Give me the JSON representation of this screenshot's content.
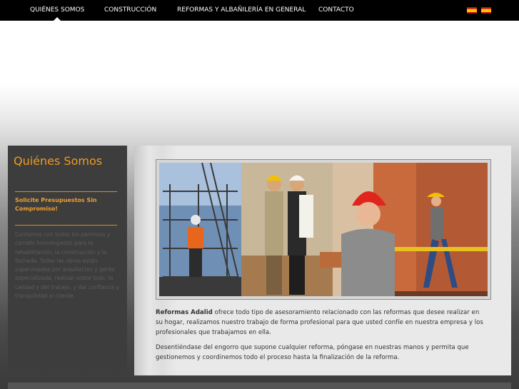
{
  "nav": {
    "items": [
      {
        "label": "QUIÉNES SOMOS",
        "active": true
      },
      {
        "label": "CONSTRUCCIÓN",
        "active": false
      },
      {
        "label": "REFORMAS Y ALBAÑILERÍA EN GENERAL",
        "active": false
      },
      {
        "label": "CONTACTO",
        "active": false
      }
    ],
    "flags": [
      "spanish-flag-icon",
      "spanish-flag-icon"
    ]
  },
  "sidebar": {
    "title": "Quiénes Somos",
    "quote_link": "Solicite Presupuestos Sin Compromiso!",
    "text": "Contamos con todos los permisos y carnets homologados para la rehabilitación, la construcción y la fachada. Todas las obras están supervisadas por arquitectos y gente especializada, realizar sobre todo, la calidad y del trabajo, y dar confianza y tranquilidad al cliente."
  },
  "content": {
    "photo_icon": "construction-workers-photo",
    "p1_brand": "Reformas Adalid",
    "p1_rest": " ofrece todo tipo de asesoramiento relacionado con las reformas que desee realizar en su hogar, realizamos nuestro trabajo de forma profesional para que usted confíe en nuestra empresa y los profesionales que trabajamos en ella.",
    "p2": "Desentiéndase del engorro que supone cualquier reforma, póngase en nuestras manos y permita que gestionemos y coordinemos todo el proceso hasta la finalización de la reforma."
  },
  "colors": {
    "nav_bg": "#000000",
    "accent": "#f09a1e",
    "sidebar_bg": "#3d3d3d",
    "content_bg": "#e9e9e9"
  }
}
